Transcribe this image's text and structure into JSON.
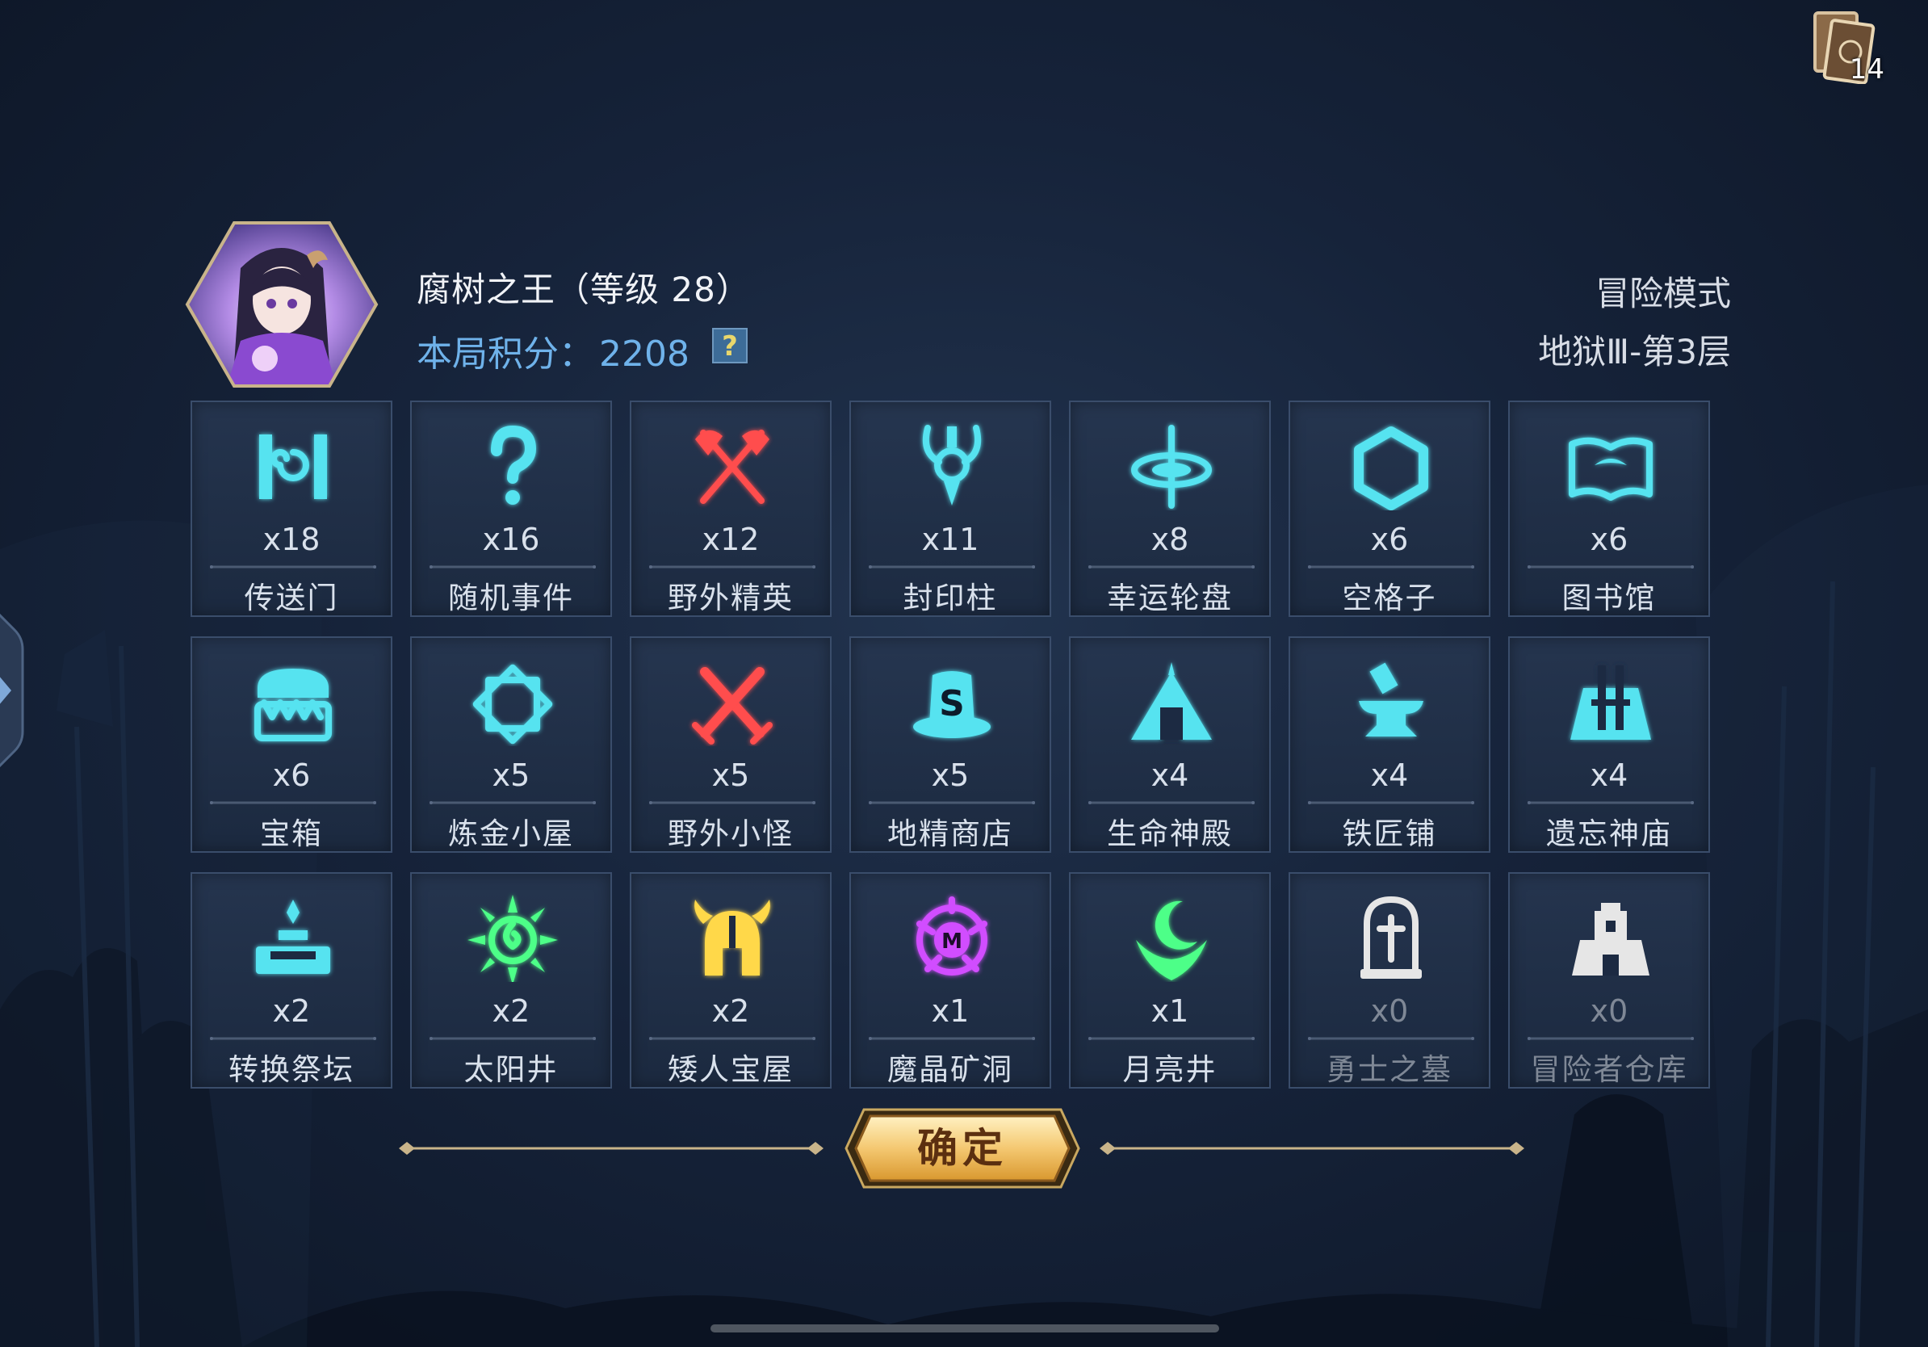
{
  "deck": {
    "count": "14",
    "icon": "card-deck-icon"
  },
  "player": {
    "name": "腐树之王（等级 28）",
    "score_label": "本局积分：",
    "score_value": "2208",
    "help": "?"
  },
  "mode": {
    "title": "冒险模式",
    "stage": "地狱Ⅲ-第3层"
  },
  "tiles": [
    {
      "icon": "portal-icon",
      "count": "x18",
      "label": "传送门",
      "color": "#56e3f0"
    },
    {
      "icon": "question-mark-icon",
      "count": "x16",
      "label": "随机事件",
      "color": "#56e3f0"
    },
    {
      "icon": "crossed-axes-icon",
      "count": "x12",
      "label": "野外精英",
      "color": "#ff4d4d"
    },
    {
      "icon": "seal-pillar-icon",
      "count": "x11",
      "label": "封印柱",
      "color": "#56e3f0"
    },
    {
      "icon": "fortune-wheel-icon",
      "count": "x8",
      "label": "幸运轮盘",
      "color": "#56e3f0"
    },
    {
      "icon": "hexagon-icon",
      "count": "x6",
      "label": "空格子",
      "color": "#56e3f0"
    },
    {
      "icon": "open-book-icon",
      "count": "x6",
      "label": "图书馆",
      "color": "#56e3f0"
    },
    {
      "icon": "mimic-chest-icon",
      "count": "x6",
      "label": "宝箱",
      "color": "#56e3f0"
    },
    {
      "icon": "alchemy-diamond-icon",
      "count": "x5",
      "label": "炼金小屋",
      "color": "#56e3f0"
    },
    {
      "icon": "crossed-swords-icon",
      "count": "x5",
      "label": "野外小怪",
      "color": "#ff4d4d"
    },
    {
      "icon": "goblin-hat-icon",
      "count": "x5",
      "label": "地精商店",
      "color": "#56e3f0"
    },
    {
      "icon": "life-temple-icon",
      "count": "x4",
      "label": "生命神殿",
      "color": "#56e3f0"
    },
    {
      "icon": "anvil-icon",
      "count": "x4",
      "label": "铁匠铺",
      "color": "#56e3f0"
    },
    {
      "icon": "forgotten-temple-icon",
      "count": "x4",
      "label": "遗忘神庙",
      "color": "#56e3f0"
    },
    {
      "icon": "altar-icon",
      "count": "x2",
      "label": "转换祭坛",
      "color": "#56e3f0"
    },
    {
      "icon": "sun-well-icon",
      "count": "x2",
      "label": "太阳井",
      "color": "#4dff88"
    },
    {
      "icon": "dwarf-helmet-icon",
      "count": "x2",
      "label": "矮人宝屋",
      "color": "#ffd84a"
    },
    {
      "icon": "magic-crystal-icon",
      "count": "x1",
      "label": "魔晶矿洞",
      "color": "#d14dff"
    },
    {
      "icon": "moon-well-icon",
      "count": "x1",
      "label": "月亮井",
      "color": "#4dff88"
    },
    {
      "icon": "tombstone-icon",
      "count": "x0",
      "label": "勇士之墓",
      "color": "#e6e6e6"
    },
    {
      "icon": "castle-icon",
      "count": "x0",
      "label": "冒险者仓库",
      "color": "#e6e6e6"
    }
  ],
  "confirm": {
    "label": "确定"
  }
}
